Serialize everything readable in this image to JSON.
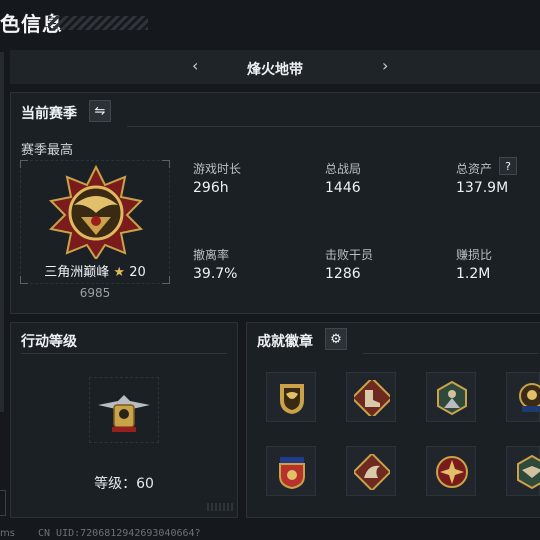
{
  "header": {
    "title": "色信息"
  },
  "map_selector": {
    "prev": "‹",
    "name": "烽火地带",
    "next": "›"
  },
  "season": {
    "title": "当前赛季",
    "switch_icon": "⇋",
    "best_label": "赛季最高",
    "rank_name": "三角洲巅峰",
    "rank_star": "★",
    "rank_stars": "20",
    "rank_score": "6985",
    "stats": [
      {
        "label": "游戏时长",
        "value": "296h"
      },
      {
        "label": "总战局",
        "value": "1446"
      },
      {
        "label": "总资产",
        "value": "137.9M",
        "help": "?"
      },
      {
        "label": "撤离率",
        "value": "39.7%"
      },
      {
        "label": "击败干员",
        "value": "1286"
      },
      {
        "label": "赚损比",
        "value": "1.2M"
      }
    ]
  },
  "action_level": {
    "title": "行动等级",
    "level_text": "等级：60"
  },
  "achievements": {
    "title": "成就徽章",
    "settings_icon": "⚙",
    "badges": [
      "bird-shield-badge",
      "boot-badge",
      "soldier-hex-badge",
      "laurel-skull-badge",
      "star-shield-badge",
      "dragon-badge",
      "cross-star-badge",
      "wings-hex-badge"
    ]
  },
  "footer": {
    "ms": "ms",
    "uid": "CN UID:7206812942693040664?"
  },
  "colors": {
    "gold": "#c9a24a",
    "red": "#8a1f1f",
    "panel": "#1b2025"
  }
}
